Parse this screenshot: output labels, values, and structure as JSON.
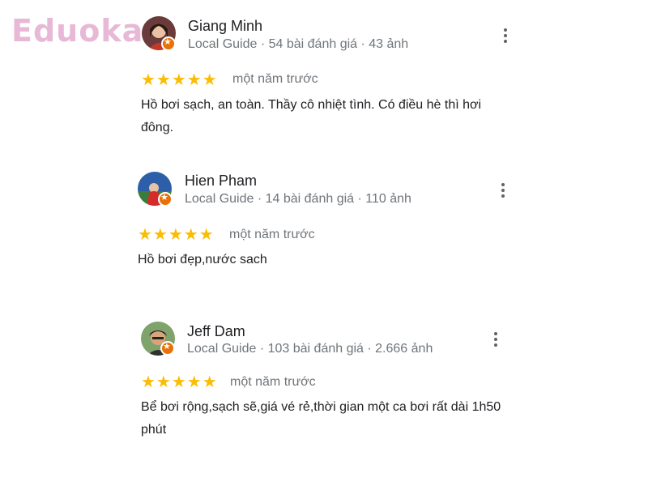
{
  "watermark": "Eduoka",
  "reviews": [
    {
      "name": "Giang Minh",
      "meta": "Local Guide · 54 bài đánh giá · 43 ảnh",
      "stars": "★★★★★",
      "rating": 5,
      "time": "một năm trước",
      "text": "Hồ bơi sạch, an toàn. Thầy cô nhiệt tình. Có điều hè thì hơi đông."
    },
    {
      "name": "Hien Pham",
      "meta": "Local Guide · 14 bài đánh giá · 110 ảnh",
      "stars": "★★★★★",
      "rating": 5,
      "time": "một năm trước",
      "text": "Hồ bơi đẹp,nước sach"
    },
    {
      "name": "Jeff Dam",
      "meta": "Local Guide · 103 bài đánh giá · 2.666 ảnh",
      "stars": "★★★★★",
      "rating": 5,
      "time": "một năm trước",
      "text": "Bể bơi rộng,sạch sẽ,giá vé rẻ,thời gian một ca bơi rất dài 1h50 phút"
    }
  ]
}
